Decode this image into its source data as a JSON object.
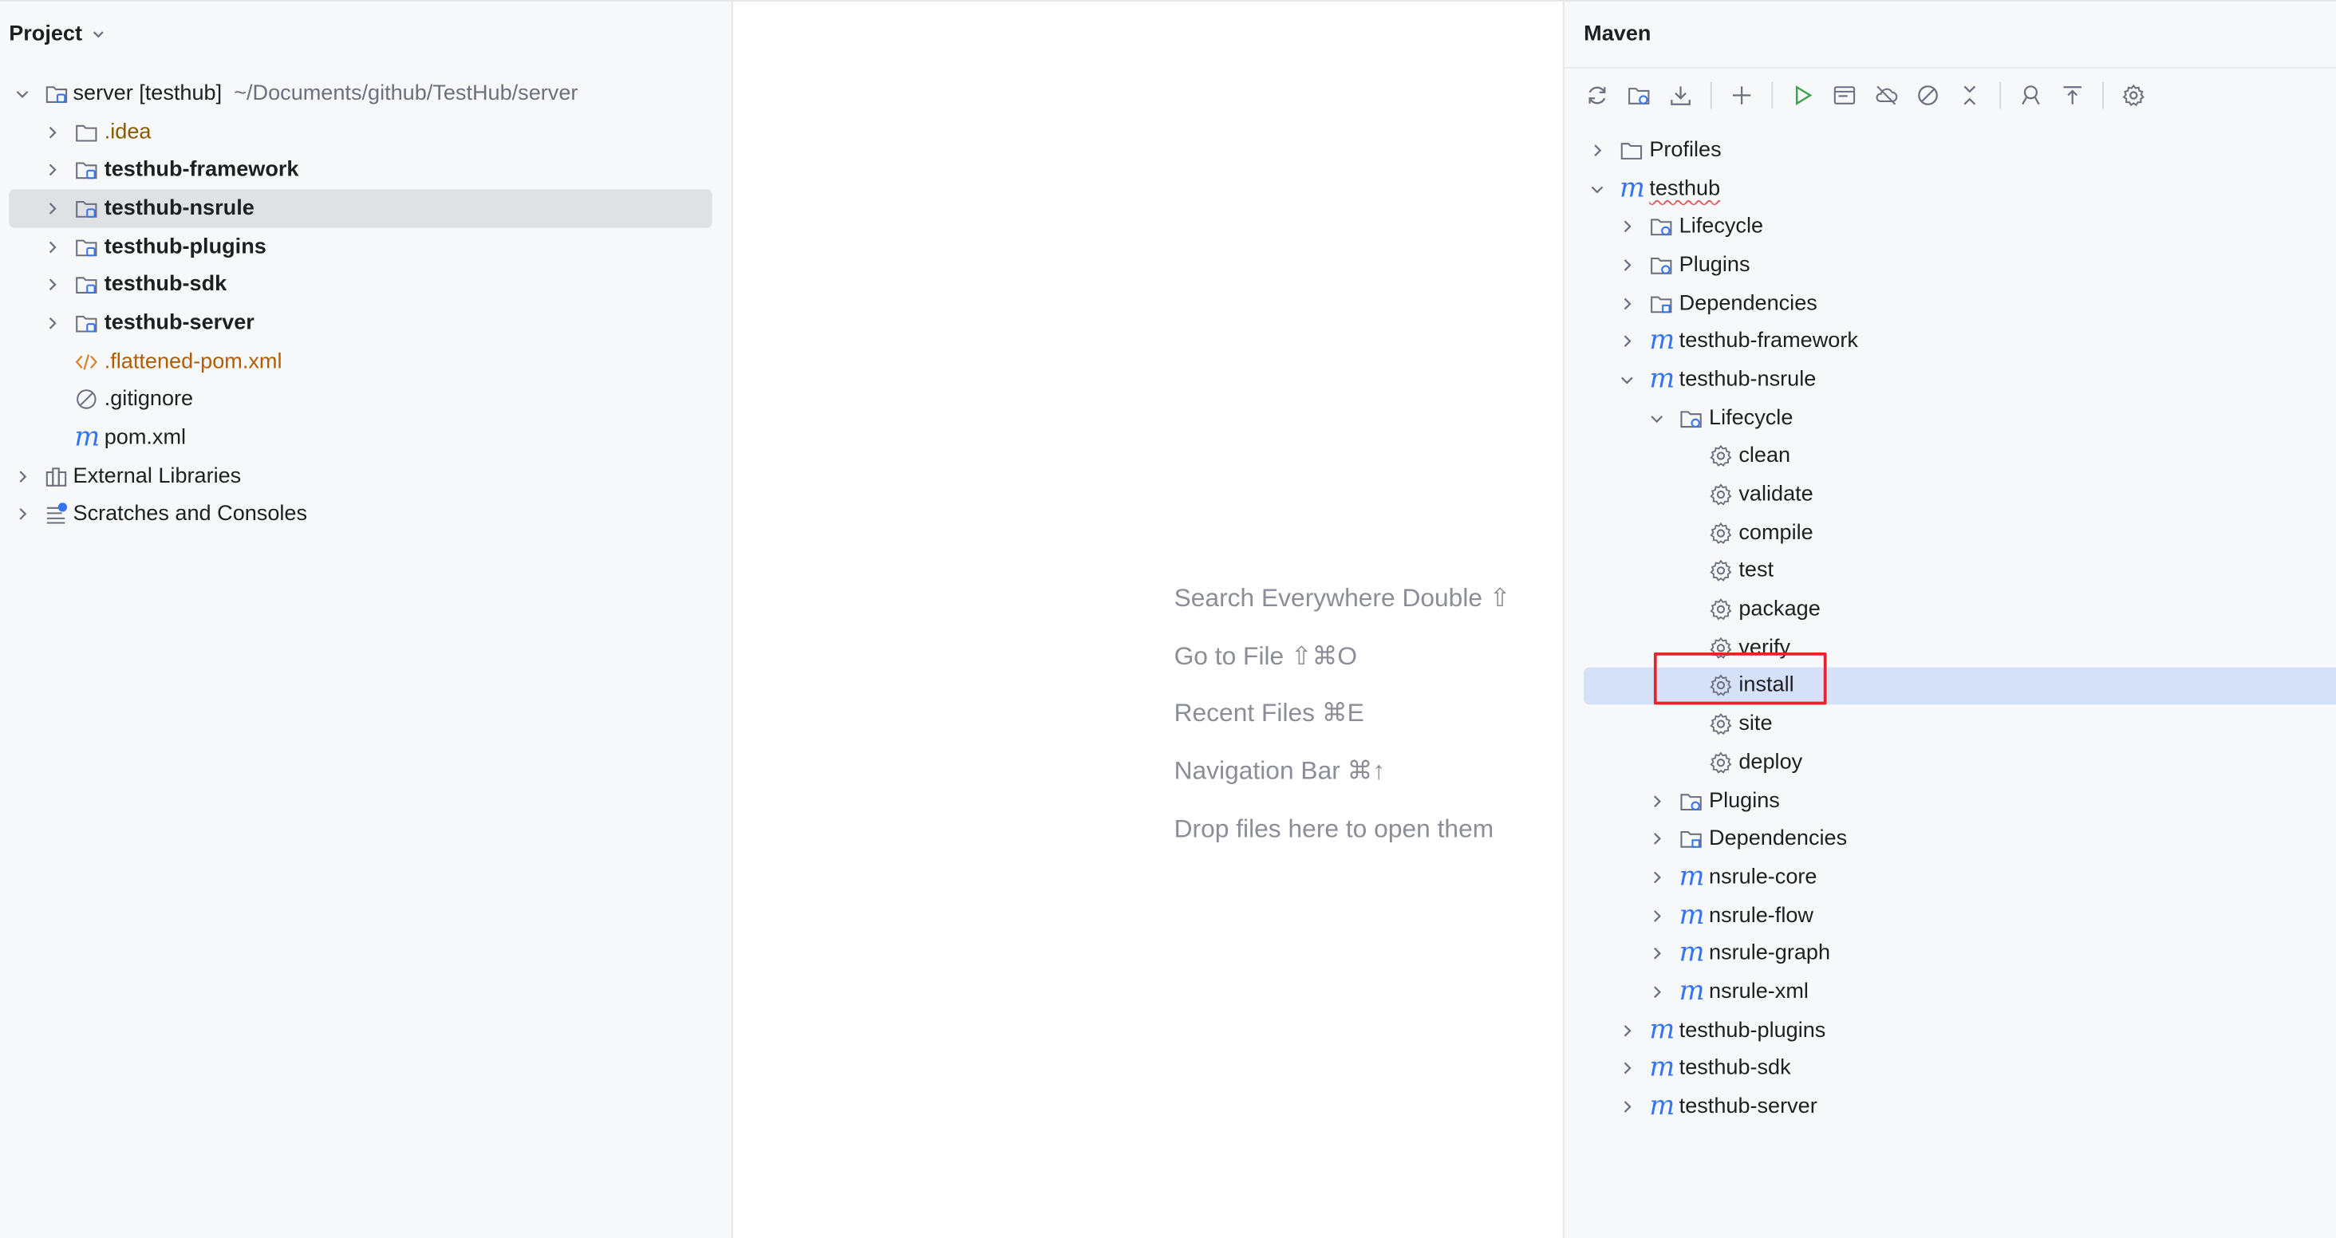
{
  "project": {
    "title": "Project",
    "root": {
      "name": "server [testhub]",
      "path": "~/Documents/github/TestHub/server"
    },
    "items": [
      {
        "label": ".idea"
      },
      {
        "label": "testhub-framework"
      },
      {
        "label": "testhub-nsrule"
      },
      {
        "label": "testhub-plugins"
      },
      {
        "label": "testhub-sdk"
      },
      {
        "label": "testhub-server"
      },
      {
        "label": ".flattened-pom.xml"
      },
      {
        "label": ".gitignore"
      },
      {
        "label": "pom.xml"
      }
    ],
    "external_libraries": "External Libraries",
    "scratches": "Scratches and Consoles"
  },
  "editor": {
    "hints": [
      "Search Everywhere Double ⇧",
      "Go to File ⇧⌘O",
      "Recent Files ⌘E",
      "Navigation Bar ⌘↑",
      "Drop files here to open them"
    ]
  },
  "maven": {
    "title": "Maven",
    "profiles": "Profiles",
    "root": "testhub",
    "root_children": {
      "lifecycle": "Lifecycle",
      "plugins": "Plugins",
      "dependencies": "Dependencies",
      "framework": "testhub-framework",
      "nsrule": "testhub-nsrule",
      "plugins_mod": "testhub-plugins",
      "sdk": "testhub-sdk",
      "server": "testhub-server"
    },
    "nsrule_children": {
      "lifecycle": "Lifecycle",
      "phases": [
        "clean",
        "validate",
        "compile",
        "test",
        "package",
        "verify",
        "install",
        "site",
        "deploy"
      ],
      "plugins": "Plugins",
      "dependencies": "Dependencies",
      "modules": [
        "nsrule-core",
        "nsrule-flow",
        "nsrule-graph",
        "nsrule-xml"
      ]
    },
    "selected_phase": "install"
  },
  "colors": {
    "accent": "#3574f0",
    "highlight_box": "#e0262d",
    "run_green": "#3fa34d"
  }
}
